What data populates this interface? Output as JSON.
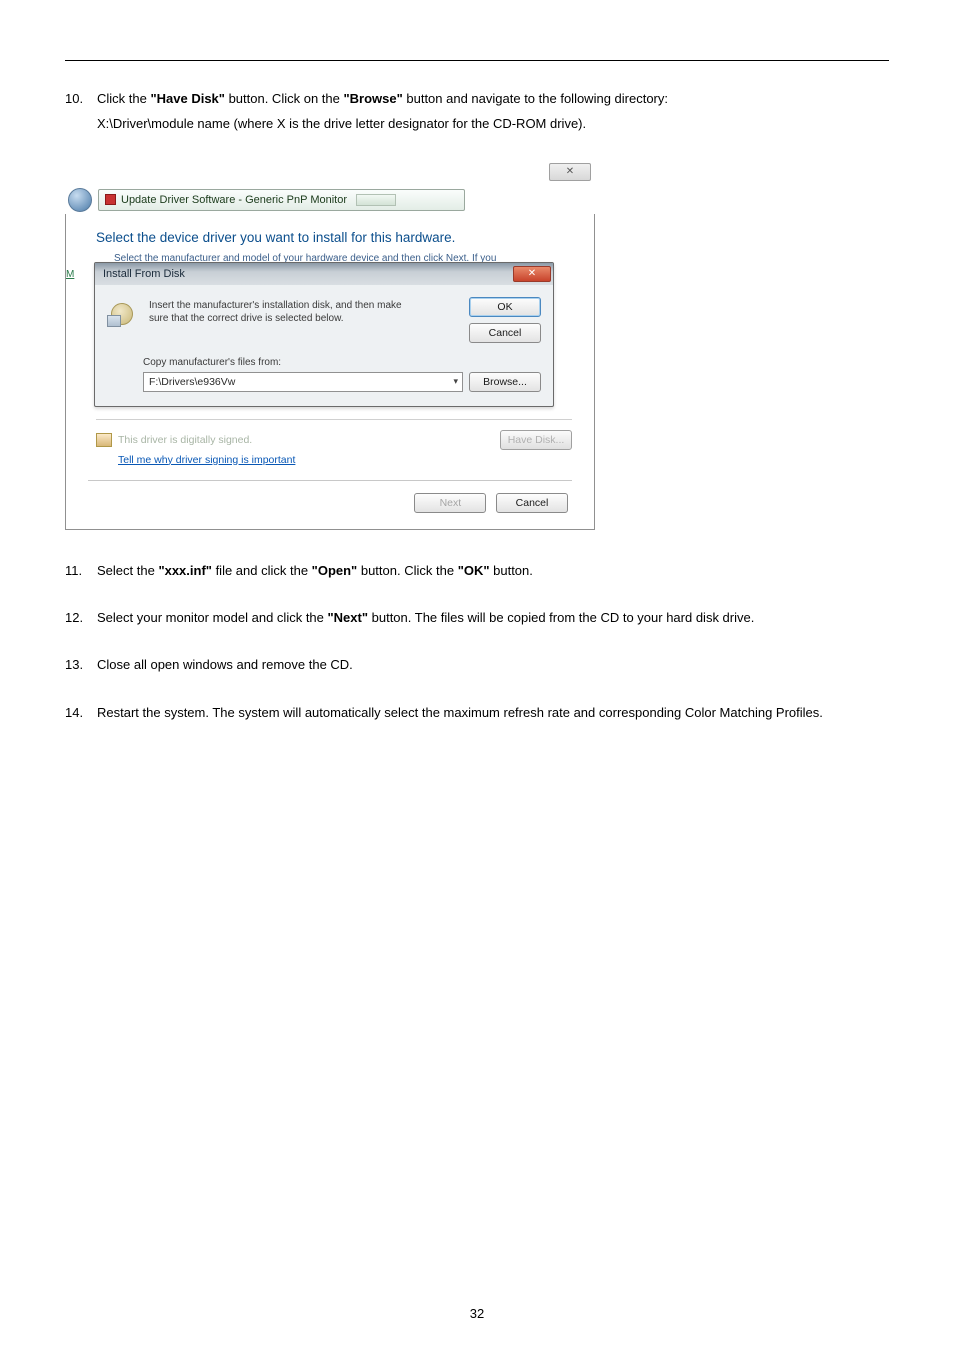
{
  "steps": {
    "s10": {
      "num": "10.",
      "l1a": "Click the ",
      "l1b": "\"Have Disk\"",
      "l1c": " button. Click on the ",
      "l1d": "\"Browse\"",
      "l1e": " button and navigate to the following directory:",
      "l2": "X:\\Driver\\module name (where X is the drive letter designator for the CD-ROM drive)."
    },
    "s11": {
      "num": "11.",
      "a": "Select the ",
      "b": "\"xxx.inf\"",
      "c": " file and click the ",
      "d": "\"Open\"",
      "e": " button. Click the ",
      "f": "\"OK\"",
      "g": " button."
    },
    "s12": {
      "num": "12.",
      "a": "Select your monitor model and click the ",
      "b": "\"Next\"",
      "c": " button. The files will be copied from the CD to your hard disk drive."
    },
    "s13": {
      "num": "13.",
      "a": "Close all open windows and remove the CD."
    },
    "s14": {
      "num": "14.",
      "a": "Restart the system. The system will automatically select the maximum refresh rate and corresponding Color Matching Profiles."
    }
  },
  "shot": {
    "close_x": "✕",
    "breadcrumb": "Update Driver Software - Generic PnP Monitor",
    "heading": "Select the device driver you want to install for this hardware.",
    "truncated": "Select the manufacturer and model of your hardware device and then click Next. If you",
    "modal_title": "Install From Disk",
    "modal_msg1": "Insert the manufacturer's installation disk, and then make",
    "modal_msg2": "sure that the correct drive is selected below.",
    "ok": "OK",
    "cancel": "Cancel",
    "copy_label": "Copy manufacturer's files from:",
    "path": "F:\\Drivers\\e936Vw",
    "browse": "Browse...",
    "sig_text": "This driver is digitally signed.",
    "have_disk": "Have Disk...",
    "link": "Tell me why driver signing is important",
    "next": "Next",
    "strip_m": "M"
  },
  "page_num": "32"
}
